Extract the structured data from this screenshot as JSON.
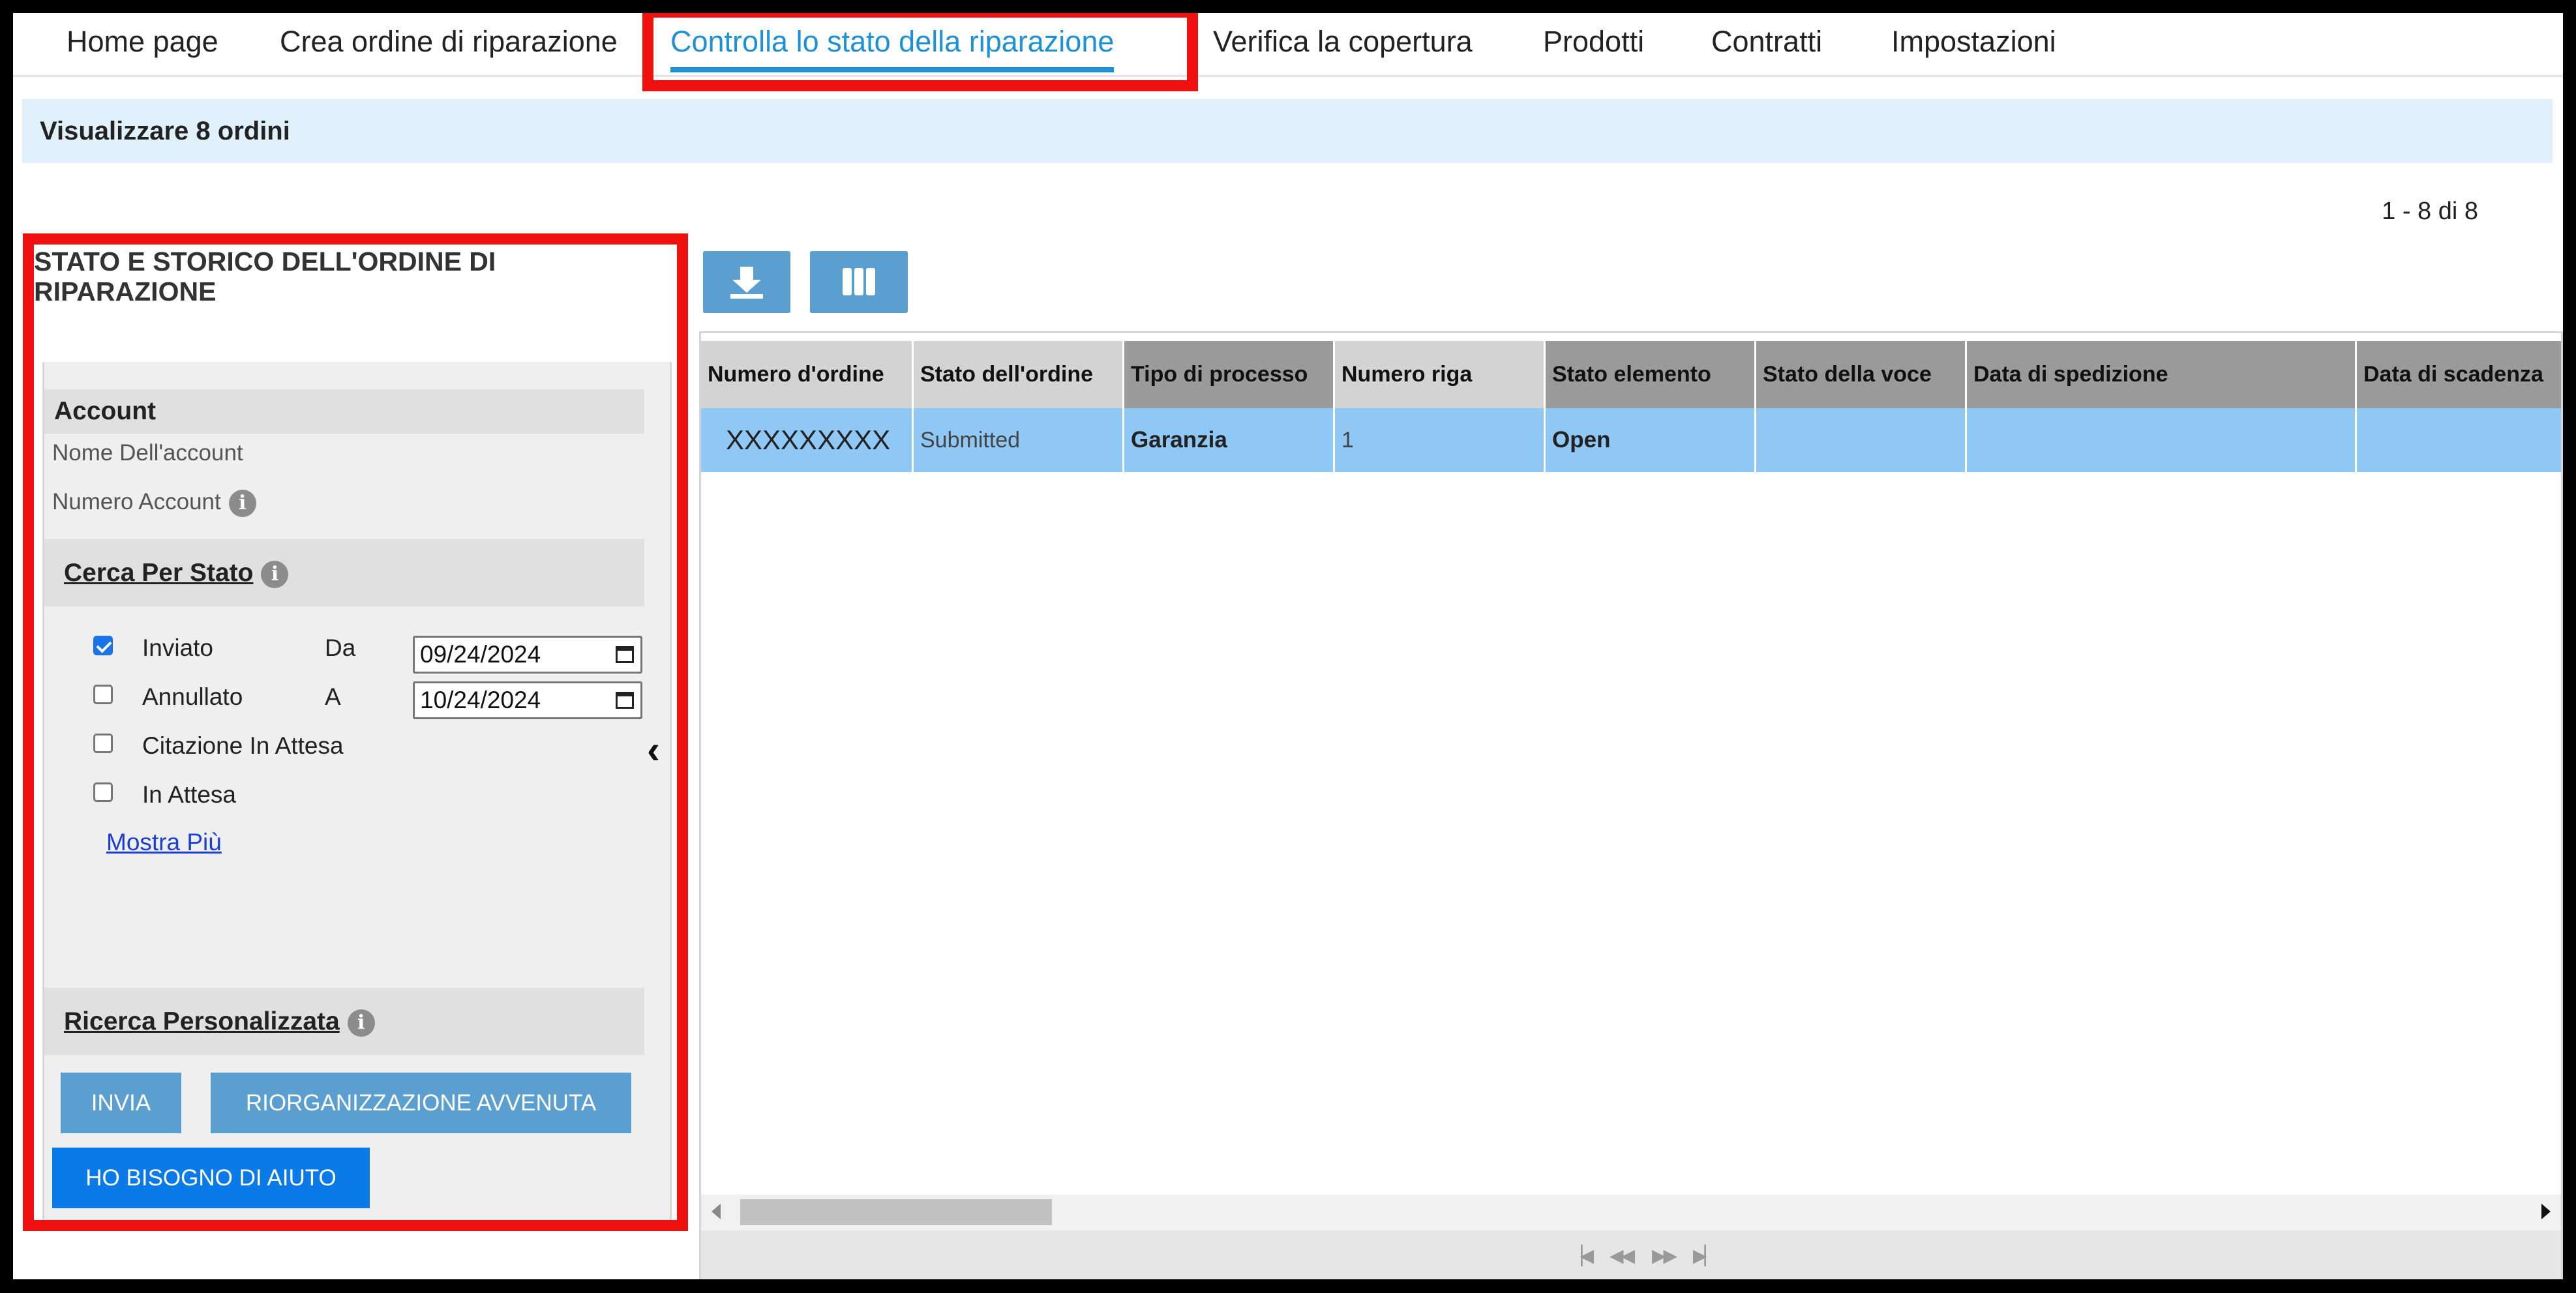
{
  "nav": {
    "items": [
      {
        "label": "Home page"
      },
      {
        "label": "Crea ordine di riparazione"
      },
      {
        "label": "Controlla lo stato della riparazione"
      },
      {
        "label": "Verifica la copertura"
      },
      {
        "label": "Prodotti"
      },
      {
        "label": "Contratti"
      },
      {
        "label": "Impostazioni"
      }
    ],
    "active_index": 2
  },
  "banner": {
    "text": "Visualizzare 8 ordini"
  },
  "pager": {
    "count": "1 - 8 di 8"
  },
  "left_panel": {
    "title": "STATO E STORICO DELL'ORDINE DI RIPARAZIONE",
    "account": {
      "heading": "Account",
      "name_label": "Nome Dell'account",
      "number_label": "Numero Account"
    },
    "status_search": {
      "heading": "Cerca Per Stato",
      "options": [
        {
          "label": "Inviato",
          "checked": true
        },
        {
          "label": "Annullato",
          "checked": false
        },
        {
          "label": "Citazione In Attesa",
          "checked": false
        },
        {
          "label": "In Attesa",
          "checked": false
        }
      ],
      "from_label": "Da",
      "from_date": "09/24/2024",
      "to_label": "A",
      "to_date": "10/24/2024",
      "show_more": "Mostra Più"
    },
    "custom_search": {
      "heading": "Ricerca Personalizzata"
    },
    "buttons": {
      "submit": "INVIA",
      "reset": "RIORGANIZZAZIONE AVVENUTA",
      "help": "HO BISOGNO DI AIUTO"
    }
  },
  "toolbar": {
    "download_icon": "download-icon",
    "columns_icon": "columns-icon"
  },
  "grid": {
    "columns": [
      "Numero d'ordine",
      "Stato dell'ordine",
      "Tipo di processo",
      "Numero riga",
      "Stato elemento",
      "Stato della voce",
      "Data di spedizione",
      "Data di scadenza"
    ],
    "rows": [
      {
        "order_number": "XXXXXXXXX",
        "order_status": "Submitted",
        "process_type": "Garanzia",
        "line_number": "1",
        "element_status": "Open",
        "item_status": "",
        "ship_date": "",
        "due_date": ""
      }
    ]
  },
  "colors": {
    "accent": "#1e90d6",
    "highlight": "#f01010",
    "selected_row": "#8fc7f5",
    "button": "#5a9fd0",
    "help_button": "#0a7ae8"
  }
}
